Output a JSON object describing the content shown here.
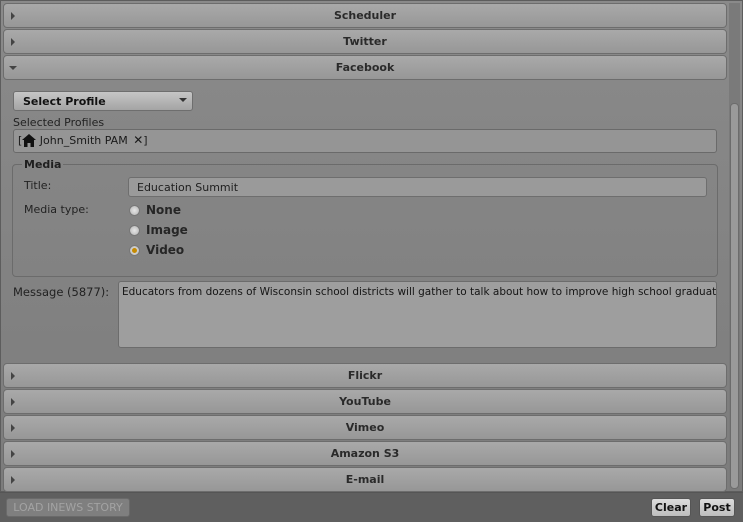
{
  "sections": {
    "scheduler": "Scheduler",
    "twitter": "Twitter",
    "facebook": "Facebook",
    "flickr": "Flickr",
    "youtube": "YouTube",
    "vimeo": "Vimeo",
    "amazon": "Amazon S3",
    "email": "E-mail"
  },
  "facebook": {
    "select_profile": "Select Profile",
    "selected_profiles_label": "Selected Profiles",
    "profile_open_bracket": "[",
    "profile_name": "John_Smith PAM",
    "profile_close": "]",
    "remove_symbol": "✕",
    "media": {
      "legend": "Media",
      "title_label": "Title:",
      "title_value": "Education Summit",
      "media_type_label": "Media type:",
      "options": [
        "None",
        "Image",
        "Video"
      ],
      "selected": "Video"
    },
    "message_label": "Message (5877):",
    "message_value": "Educators from dozens of Wisconsin school districts will gather to talk about how to improve high school graduation rates."
  },
  "footer": {
    "load_story": "LOAD INEWS STORY",
    "clear": "Clear",
    "post": "Post"
  },
  "icons": {
    "profile": "home-icon",
    "collapsed": "triangle-right-icon",
    "expanded": "triangle-down-icon"
  },
  "colors": {
    "radio_selected": "#c58a00",
    "panel_bg": "#7e7e7e"
  }
}
